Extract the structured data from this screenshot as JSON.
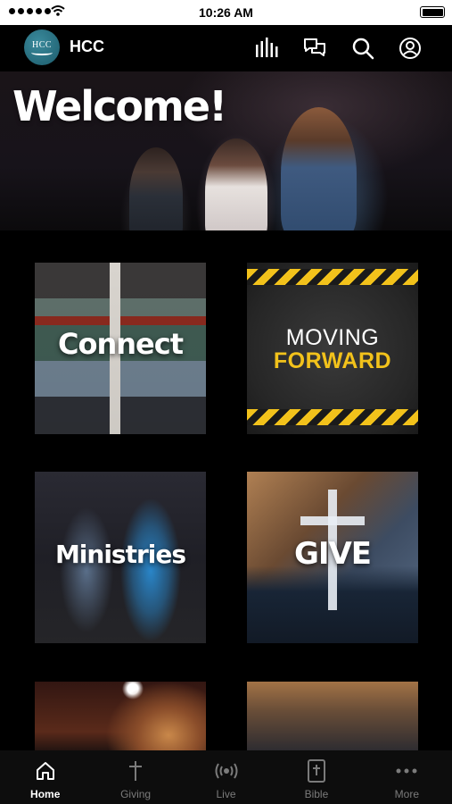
{
  "status_bar": {
    "time": "10:26 AM"
  },
  "header": {
    "logo_text": "HCC",
    "title": "HCC"
  },
  "hero": {
    "title": "Welcome!"
  },
  "tiles": {
    "connect": "Connect",
    "moving": {
      "line1": "MOVING",
      "line2": "FORWARD"
    },
    "ministries": "Ministries",
    "give": "GIVE"
  },
  "tabs": [
    {
      "label": "Home",
      "icon": "home-icon",
      "active": true
    },
    {
      "label": "Giving",
      "icon": "cross-icon",
      "active": false
    },
    {
      "label": "Live",
      "icon": "broadcast-icon",
      "active": false
    },
    {
      "label": "Bible",
      "icon": "bible-icon",
      "active": false
    },
    {
      "label": "More",
      "icon": "more-icon",
      "active": false
    }
  ],
  "colors": {
    "accent_yellow": "#f2c21b",
    "background": "#000000",
    "inactive_tab": "#7b7b7b"
  }
}
